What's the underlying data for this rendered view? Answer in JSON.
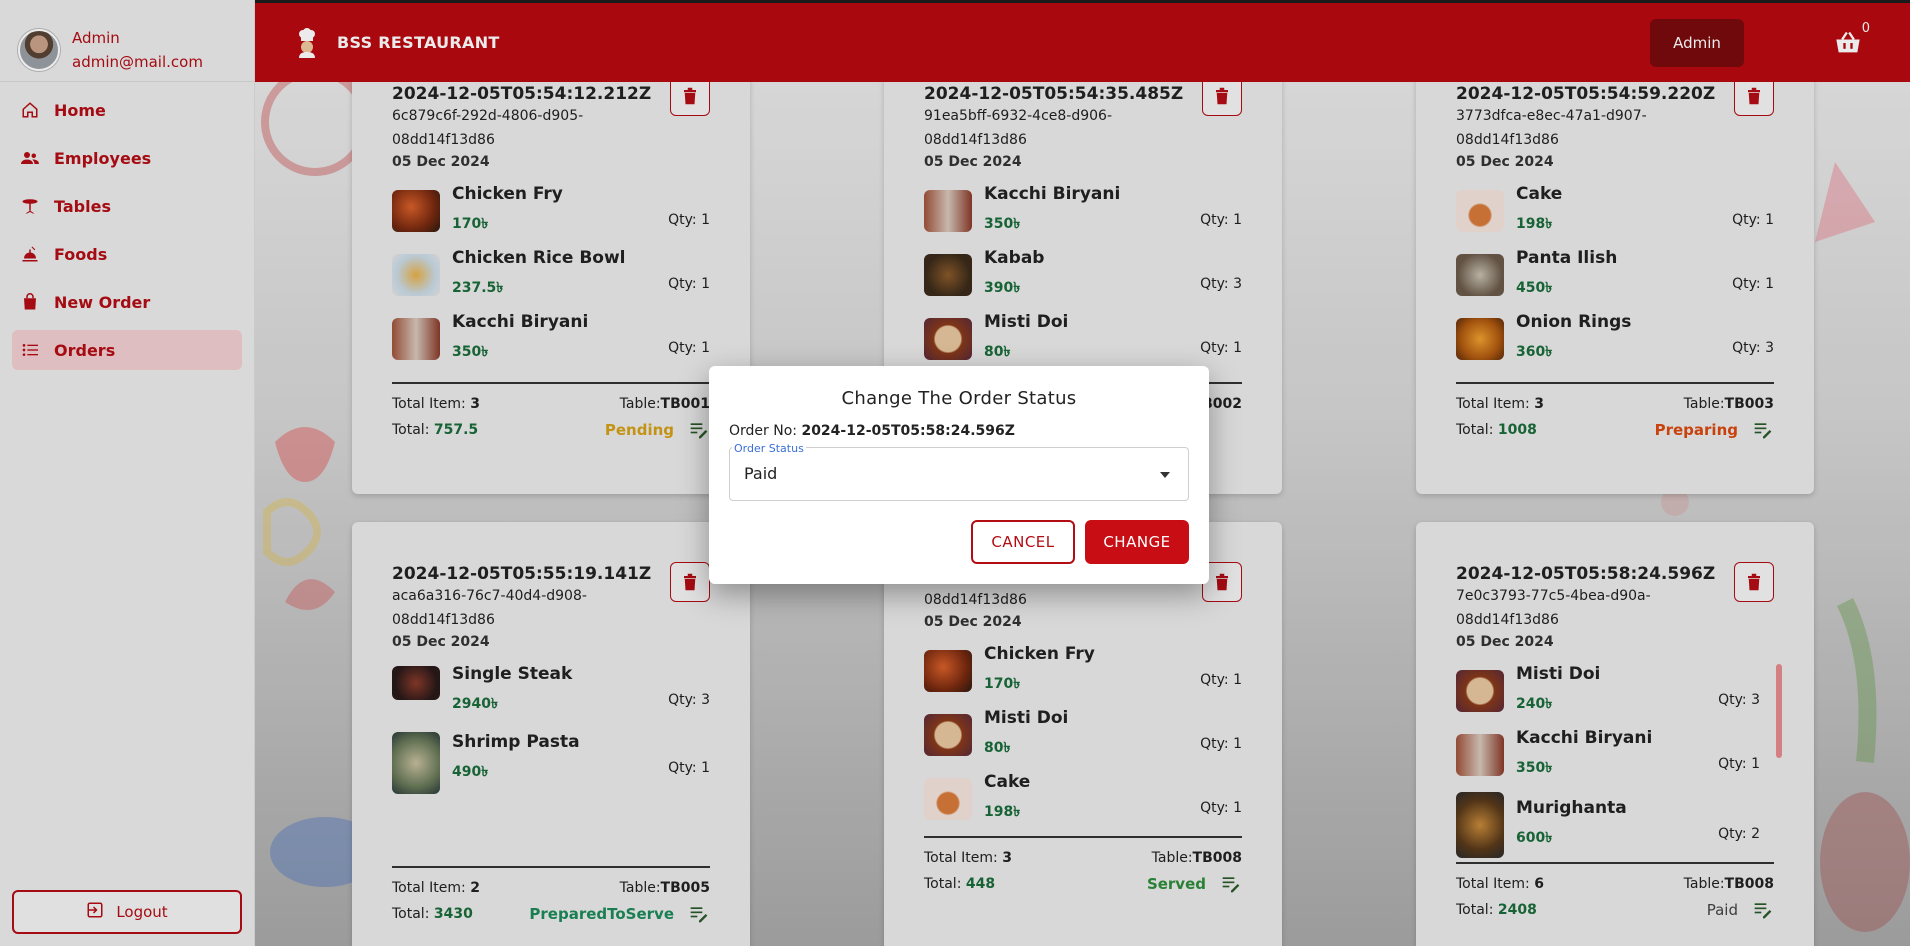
{
  "user": {
    "name": "Admin",
    "email": "admin@mail.com"
  },
  "nav": [
    {
      "label": "Home",
      "icon": "home-icon",
      "active": false
    },
    {
      "label": "Employees",
      "icon": "people-icon",
      "active": false
    },
    {
      "label": "Tables",
      "icon": "table-icon",
      "active": false
    },
    {
      "label": "Foods",
      "icon": "food-icon",
      "active": false
    },
    {
      "label": "New Order",
      "icon": "bag-icon",
      "active": false
    },
    {
      "label": "Orders",
      "icon": "list-icon",
      "active": true
    }
  ],
  "logout_label": "Logout",
  "header": {
    "brand": "BSS RESTAURANT",
    "admin_label": "Admin",
    "cart_count": "0"
  },
  "labels": {
    "total_item": "Total Item:",
    "total": "Total:",
    "table": "Table:",
    "qty": "Qty:"
  },
  "colors": {
    "primary": "#b80a10",
    "price": "#1a6c3a",
    "pending": "#d4a017",
    "preparing": "#d9480f",
    "prepared": "#1c8a5a",
    "served": "#2e8b3a",
    "paid": "#444444"
  },
  "orders": [
    {
      "id": "2024-12-05T05:54:12.212Z",
      "guid": "6c879c6f-292d-4806-d905-08dd14f13d86",
      "date": "05 Dec 2024",
      "items": [
        {
          "name": "Chicken Fry",
          "price": "170৳",
          "qty": "1"
        },
        {
          "name": "Chicken Rice Bowl",
          "price": "237.5৳",
          "qty": "1"
        },
        {
          "name": "Kacchi Biryani",
          "price": "350৳",
          "qty": "1"
        }
      ],
      "total_items": "3",
      "table": "TB001",
      "total": "757.5",
      "status": "Pending"
    },
    {
      "id": "2024-12-05T05:54:35.485Z",
      "guid": "91ea5bff-6932-4ce8-d906-08dd14f13d86",
      "date": "05 Dec 2024",
      "items": [
        {
          "name": "Kacchi Biryani",
          "price": "350৳",
          "qty": "1"
        },
        {
          "name": "Kabab",
          "price": "390৳",
          "qty": "3"
        },
        {
          "name": "Misti Doi",
          "price": "80৳",
          "qty": "1"
        }
      ],
      "total_items": "",
      "table": "TB002",
      "total": "",
      "status": ""
    },
    {
      "id": "2024-12-05T05:54:59.220Z",
      "guid": "3773dfca-e8ec-47a1-d907-08dd14f13d86",
      "date": "05 Dec 2024",
      "items": [
        {
          "name": "Cake",
          "price": "198৳",
          "qty": "1"
        },
        {
          "name": "Panta Ilish",
          "price": "450৳",
          "qty": "1"
        },
        {
          "name": "Onion Rings",
          "price": "360৳",
          "qty": "3"
        }
      ],
      "total_items": "3",
      "table": "TB003",
      "total": "1008",
      "status": "Preparing"
    },
    {
      "id": "2024-12-05T05:55:19.141Z",
      "guid": "aca6a316-76c7-40d4-d908-08dd14f13d86",
      "date": "05 Dec 2024",
      "items": [
        {
          "name": "Single Steak",
          "price": "2940৳",
          "qty": "3"
        },
        {
          "name": "Shrimp Pasta",
          "price": "490৳",
          "qty": "1"
        }
      ],
      "total_items": "2",
      "table": "TB005",
      "total": "3430",
      "status": "PreparedToServe"
    },
    {
      "id": "",
      "guid": "c40815bd-af39-4a4c-d909-08dd14f13d86",
      "date": "05 Dec 2024",
      "items": [
        {
          "name": "Chicken Fry",
          "price": "170৳",
          "qty": "1"
        },
        {
          "name": "Misti Doi",
          "price": "80৳",
          "qty": "1"
        },
        {
          "name": "Cake",
          "price": "198৳",
          "qty": "1"
        }
      ],
      "total_items": "3",
      "table": "TB008",
      "total": "448",
      "status": "Served"
    },
    {
      "id": "2024-12-05T05:58:24.596Z",
      "guid": "7e0c3793-77c5-4bea-d90a-08dd14f13d86",
      "date": "05 Dec 2024",
      "items": [
        {
          "name": "Misti Doi",
          "price": "240৳",
          "qty": "3"
        },
        {
          "name": "Kacchi Biryani",
          "price": "350৳",
          "qty": "1"
        },
        {
          "name": "Murighanta",
          "price": "600৳",
          "qty": "2"
        }
      ],
      "total_items": "6",
      "table": "TB008",
      "total": "2408",
      "status": "Paid"
    }
  ],
  "modal": {
    "title": "Change The Order Status",
    "order_label": "Order No:",
    "order_no": "2024-12-05T05:58:24.596Z",
    "field_label": "Order Status",
    "field_value": "Paid",
    "cancel_label": "CANCEL",
    "change_label": "CHANGE"
  }
}
